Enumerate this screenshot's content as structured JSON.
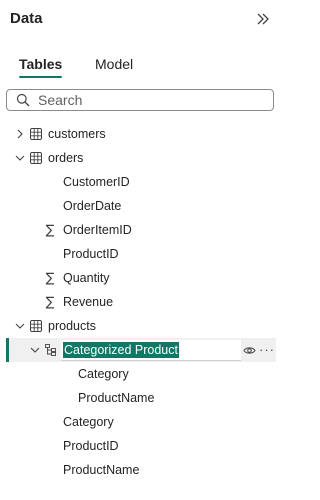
{
  "panel": {
    "title": "Data",
    "collapse_icon": "double-chevron-right-icon"
  },
  "tabs": [
    {
      "label": "Tables",
      "active": true
    },
    {
      "label": "Model",
      "active": false
    }
  ],
  "search": {
    "placeholder": "Search",
    "value": ""
  },
  "tree": {
    "customers": {
      "label": "customers",
      "expanded": false
    },
    "orders": {
      "label": "orders",
      "expanded": true,
      "fields": [
        "CustomerID",
        "OrderDate",
        "OrderItemID",
        "ProductID",
        "Quantity",
        "Revenue"
      ]
    },
    "products": {
      "label": "products",
      "expanded": true,
      "hierarchy": {
        "label": "Categorized Product",
        "editing": true,
        "levels": [
          "Category",
          "ProductName"
        ]
      },
      "fields": [
        "Category",
        "ProductID",
        "ProductName"
      ]
    }
  },
  "colors": {
    "accent": "#117865"
  }
}
